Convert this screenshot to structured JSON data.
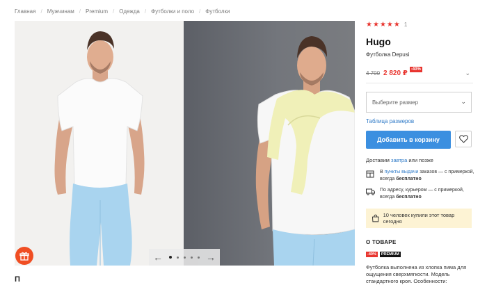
{
  "breadcrumb": [
    "Главная",
    "Мужчинам",
    "Premium",
    "Одежда",
    "Футболки и поло",
    "Футболки"
  ],
  "rating": {
    "stars": 5,
    "count": "1"
  },
  "product": {
    "brand": "Hugo",
    "name": "Футболка Depusi",
    "old_price": "4 700",
    "new_price": "2 820 ₽",
    "discount": "-40%"
  },
  "size_select": {
    "placeholder": "Выберите размер"
  },
  "size_table_link": "Таблица размеров",
  "add_to_cart": "Добавить в корзину",
  "delivery": {
    "prefix": "Доставим",
    "link": "завтра",
    "suffix": "или позже",
    "option1": {
      "pre": "В",
      "link": "пункты выдачи",
      "text": "заказов — с примеркой, всегда",
      "bold": "бесплатно"
    },
    "option2": {
      "text": "По адресу, курьером — с примеркой, всегда",
      "bold": "бесплатно"
    }
  },
  "popular_note": "10 человек купили этот товар сегодня",
  "about": {
    "title": "О ТОВАРЕ",
    "badge_discount": "-40%",
    "badge_premium": "PREMIUM",
    "description": "Футболка выполнена из хлопка пима для ощущения сверхмягкости. Модель стандартного кроя. Особенности:"
  },
  "gallery": {
    "dots": 5,
    "active_dot": 0
  },
  "below_gallery_text": "П",
  "colors": {
    "accent_red": "#e8352f",
    "cart_blue": "#3b8fe0",
    "link_blue": "#2d79c7",
    "popular_bg": "#fdf3d4",
    "badge_orange": "#f04e23"
  },
  "icons": [
    "chevron-down-icon",
    "heart-icon",
    "pickup-point-icon",
    "courier-truck-icon",
    "shopping-bag-icon",
    "arrow-left-icon",
    "arrow-right-icon",
    "gift-icon"
  ]
}
